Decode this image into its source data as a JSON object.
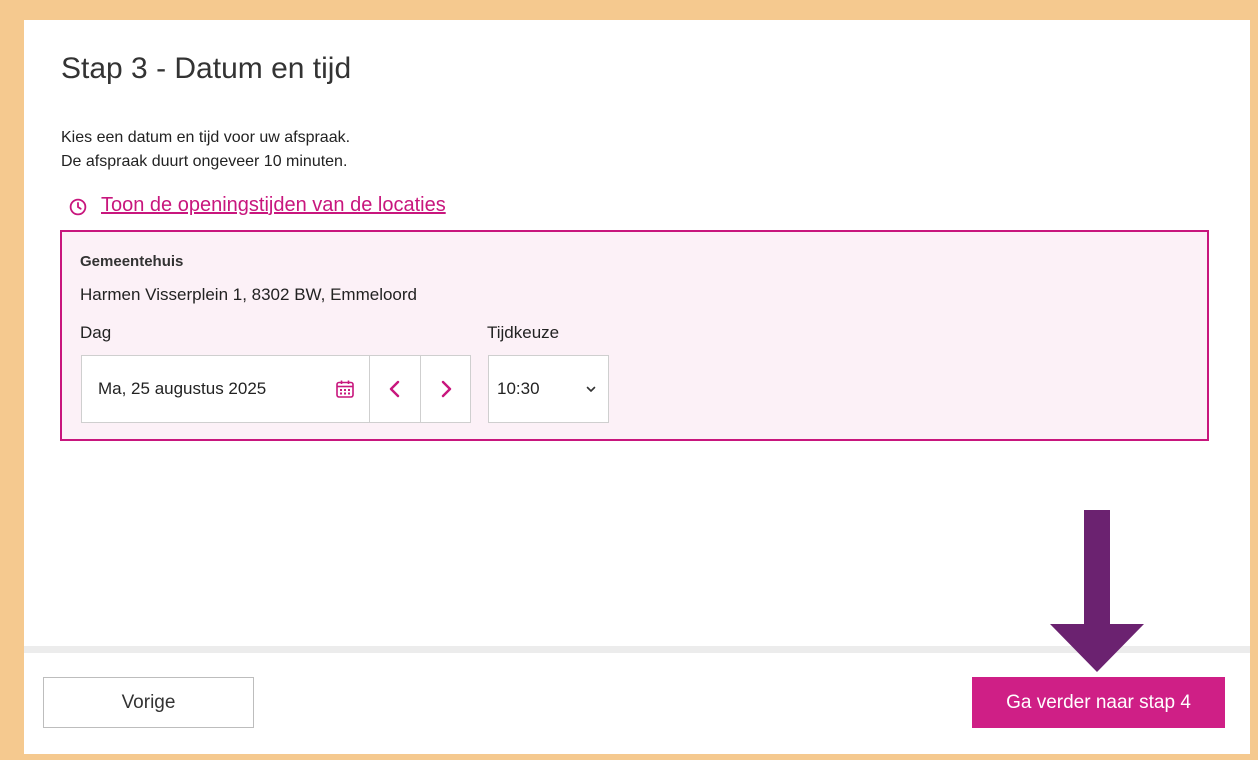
{
  "step": {
    "title": "Stap 3 - Datum en tijd",
    "intro_line1": "Kies een datum en tijd voor uw afspraak.",
    "intro_line2": "De afspraak duurt ongeveer 10 minuten."
  },
  "opening_hours_link": "Toon de openingstijden van de locaties",
  "location": {
    "name": "Gemeentehuis",
    "address": "Harmen Visserplein 1, 8302 BW, Emmeloord",
    "day_label": "Dag",
    "day_value": "Ma, 25 augustus 2025",
    "time_label": "Tijdkeuze",
    "time_value": "10:30"
  },
  "footer": {
    "prev_label": "Vorige",
    "next_label": "Ga verder naar stap 4"
  },
  "colors": {
    "accent": "#cf1f86",
    "frame": "#f5c98f",
    "highlight_arrow": "#6b2270"
  },
  "icons": {
    "clock": "clock-icon",
    "calendar": "calendar-icon",
    "prev_day": "chevron-left-icon",
    "next_day": "chevron-right-icon",
    "select": "chevron-down-icon",
    "arrow": "arrow-down-icon"
  }
}
